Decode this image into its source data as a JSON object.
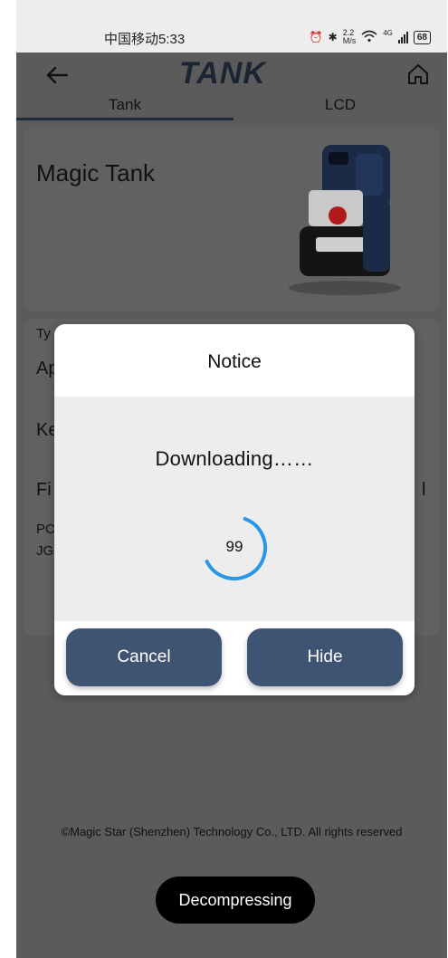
{
  "status_bar": {
    "carrier_time": "中国移动5:33",
    "net_speed_top": "2.2",
    "net_speed_unit": "M/s",
    "network_type": "4G",
    "battery": "68"
  },
  "header": {
    "brand": "TANK",
    "back_icon": "arrow-left-icon",
    "home_icon": "home-icon"
  },
  "tabs": [
    {
      "label": "Tank",
      "active": true
    },
    {
      "label": "LCD",
      "active": false
    }
  ],
  "card": {
    "title": "Magic Tank"
  },
  "info_rows": [
    {
      "text": "Ty"
    },
    {
      "text": "Ap"
    },
    {
      "text": "Ke"
    },
    {
      "text": "Fi",
      "right": "l"
    },
    {
      "text": "PC"
    },
    {
      "text": "JG"
    }
  ],
  "dialog": {
    "title": "Notice",
    "message": "Downloading……",
    "progress_value": "99",
    "progress_fraction": 0.99,
    "cancel_label": "Cancel",
    "hide_label": "Hide"
  },
  "footer": {
    "copyright": "©Magic Star (Shenzhen) Technology Co., LTD. All rights reserved"
  },
  "toast": {
    "text": "Decompressing"
  },
  "colors": {
    "dim_background": "#5b5b5b",
    "button": "#3f5472",
    "progress": "#2a96e6"
  }
}
